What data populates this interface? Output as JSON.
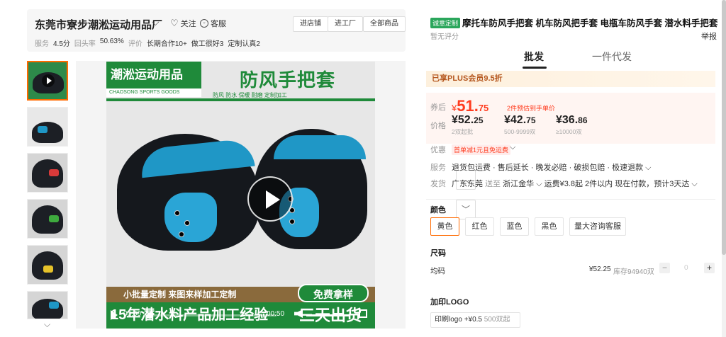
{
  "store": {
    "name": "东莞市寮步潮淞运动用品厂",
    "follow": "关注",
    "service_chat": "客服",
    "buttons": [
      "进店铺",
      "进工厂",
      "全部商品"
    ],
    "stats": {
      "service_label": "服务",
      "service_value": "4.5分",
      "repurchase_label": "回头率",
      "repurchase_value": "50.63%",
      "rating_label": "评价",
      "tag1": "长期合作10+",
      "tag2": "做工很好3",
      "tag3": "定制认真2"
    }
  },
  "poster": {
    "brand": "潮淞运动用品",
    "brand_sub": "CHAOSONG SPORTS GOODS",
    "title": "防风手把套",
    "subtitle": "防风 防水 保暖 耐磨 定制加工",
    "banner_small": "小批量定制    来图来样加工定制",
    "badge": "免费拿样",
    "bottom": "15年潜水料产品加工经验",
    "bottom_em": "三天出货"
  },
  "video": {
    "current_time": "00:00",
    "duration": "00:50"
  },
  "product": {
    "tag": "诚意定制",
    "title": "摩托车防风手把套 机车防风把手套 电瓶车防风手套 潜水料手把套",
    "rating": "暂无评分",
    "report": "举报",
    "tabs": [
      "批发",
      "一件代发"
    ],
    "plus_banner": "已享PLUS会员9.5折",
    "coupon_label": "券后",
    "coupon_yen": "¥",
    "coupon_int": "51.",
    "coupon_dec": "75",
    "coupon_note": "2件预估到手单价",
    "price_label": "价格",
    "tiers": [
      {
        "int": "¥52.",
        "dec": "25",
        "range": "2双起批"
      },
      {
        "int": "¥42.",
        "dec": "75",
        "range": "500-9999双"
      },
      {
        "int": "¥36.",
        "dec": "86",
        "range": "≥10000双"
      }
    ],
    "benefit_label": "优惠",
    "benefit_tag": "首单减1元且免运费",
    "service_label": "服务",
    "service_items": "退货包运费 · 售后延长 · 晚发必赔 · 破损包赔 · 极速退款",
    "shipping_label": "发货",
    "shipping_from": "广东东莞",
    "shipping_to_word": "送至",
    "shipping_to": "浙江金华",
    "shipping_rest": "运费¥3.8起  2件以内  现在付款，预计3天达"
  },
  "color": {
    "title": "颜色",
    "options": [
      "黄色",
      "红色",
      "蓝色",
      "黑色",
      "量大咨询客服"
    ],
    "selected": 0
  },
  "size": {
    "title": "尺码",
    "name": "均码",
    "price": "¥52.25",
    "stock": "库存94940双",
    "quantity": "0",
    "minus": "−",
    "plus": "+"
  },
  "logo": {
    "title": "加印LOGO",
    "option": "印刷logo",
    "price": "+¥0.5",
    "min": "500双起"
  },
  "colors": {
    "accent": "#ff6a00",
    "price_red": "#ff3c1f",
    "brand_green": "#1f8a3a",
    "tag_green": "#2aa65b"
  }
}
